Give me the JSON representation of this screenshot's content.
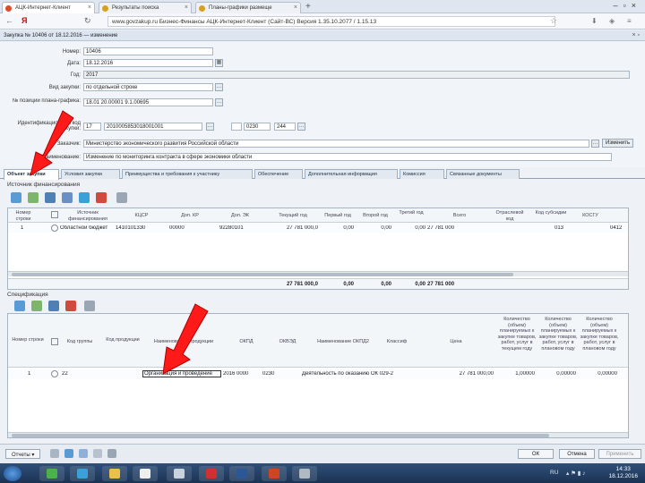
{
  "browser": {
    "tabs": [
      {
        "label": "АЦК-Интернет-Клиент",
        "icon_color": "#e04a2a"
      },
      {
        "label": "Результаты поиска",
        "icon_color": "#d6a020"
      },
      {
        "label": "Планы-графики размеще",
        "icon_color": "#d6a020"
      }
    ],
    "url": "www.govzakup.ru   Бизнес-Финансы АЦК-Интернет-Клиент (Сайт-ВС)  Версия 1.35.10.2077 / 1.15.13",
    "back_icon": "back-arrow-icon",
    "yandex_letter": "Я"
  },
  "app": {
    "header_title": "Закупка № 10406 от 18.12.2016 — изменение"
  },
  "form": {
    "number_label": "Номер:",
    "number_value": "10406",
    "date_label": "Дата:",
    "date_value": "18.12.2016",
    "year_label": "Год:",
    "year_value": "2017",
    "kind_label": "Вид закупки:",
    "kind_value": "по отдельной строке",
    "pos_label": "№ позиции плана-графика:",
    "pos_value": "18.01 20.00001 9.1.00695",
    "ikz_label": "Идентификационный код закупки:",
    "ikz_part1": "17",
    "ikz_part2": "2010005853018001001",
    "ikz_part3": "0230",
    "ikz_part4": "244",
    "org_label": "Заказчик:",
    "org_value": "Министерство экономического развития Российской области",
    "name_label": "Наименование:",
    "name_value": "Изменение по мониторинга контракта в сфере экономики области",
    "change_button": "Изменить"
  },
  "tabs": [
    "Объект закупки",
    "Условия закупки",
    "Преимущества и требования к участнику",
    "Обеспечение",
    "Дополнительная информация",
    "Комиссия",
    "Связанные документы"
  ],
  "sources": {
    "section_label": "Источник финансирования",
    "headers": [
      "Номер строки",
      "Источник финансирования",
      "КЦСР",
      "Доп. КР",
      "Доп. ЭК",
      "Текущий год",
      "Первый год",
      "Второй год",
      "Третий год",
      "Всего",
      "Отраслевой код",
      "Код субсидии",
      "КОСГУ"
    ],
    "row": {
      "num": "1",
      "source": "Областной бюджет",
      "kcsr": "1410101330",
      "dop_kr": "00000",
      "dop_ek": "92280101",
      "cur": "27 781 000,0",
      "first": "0,00",
      "second": "0,00",
      "third": "0,00",
      "total": "27 781 000",
      "subs": "013",
      "kosgu": "0412"
    },
    "sum": {
      "cur": "27 781 000,0",
      "first": "0,00",
      "second": "0,00",
      "third": "0,00",
      "total": "27 781 000"
    }
  },
  "spec": {
    "section_label": "Спецификация",
    "headers": [
      "Номер строки",
      "Код группы",
      "Код продукции",
      "Наименование продукции",
      "ОКПД",
      "ОКВЭД",
      "Наименование ОКПД2",
      "Классиф",
      "Цена",
      "Количество (объем) планируемых к закупке товаров, работ, услуг в текущем году",
      "Количество (объем) планируемых к закупке товаров, работ, услуг в плановом году",
      "Количество (объем) планируемых к закупке товаров, работ, услуг в плановом году"
    ],
    "row": {
      "num": "1",
      "group": "22",
      "product": "Организация и проведение",
      "okpd": "2016 0000",
      "okved": "0230",
      "okpd_name": "Деятельность по оказанию ОК 029-2",
      "price": "27 781 000,00",
      "q1": "1,00000",
      "q2": "0,00000",
      "q3": "0,00000"
    }
  },
  "footer": {
    "report_button": "Отчеты",
    "ok_button": "ОК",
    "cancel_button": "Отмена",
    "apply_button": "Применить"
  },
  "taskbar": {
    "time": "14:33",
    "date": "18.12.2016",
    "lang": "RU"
  }
}
